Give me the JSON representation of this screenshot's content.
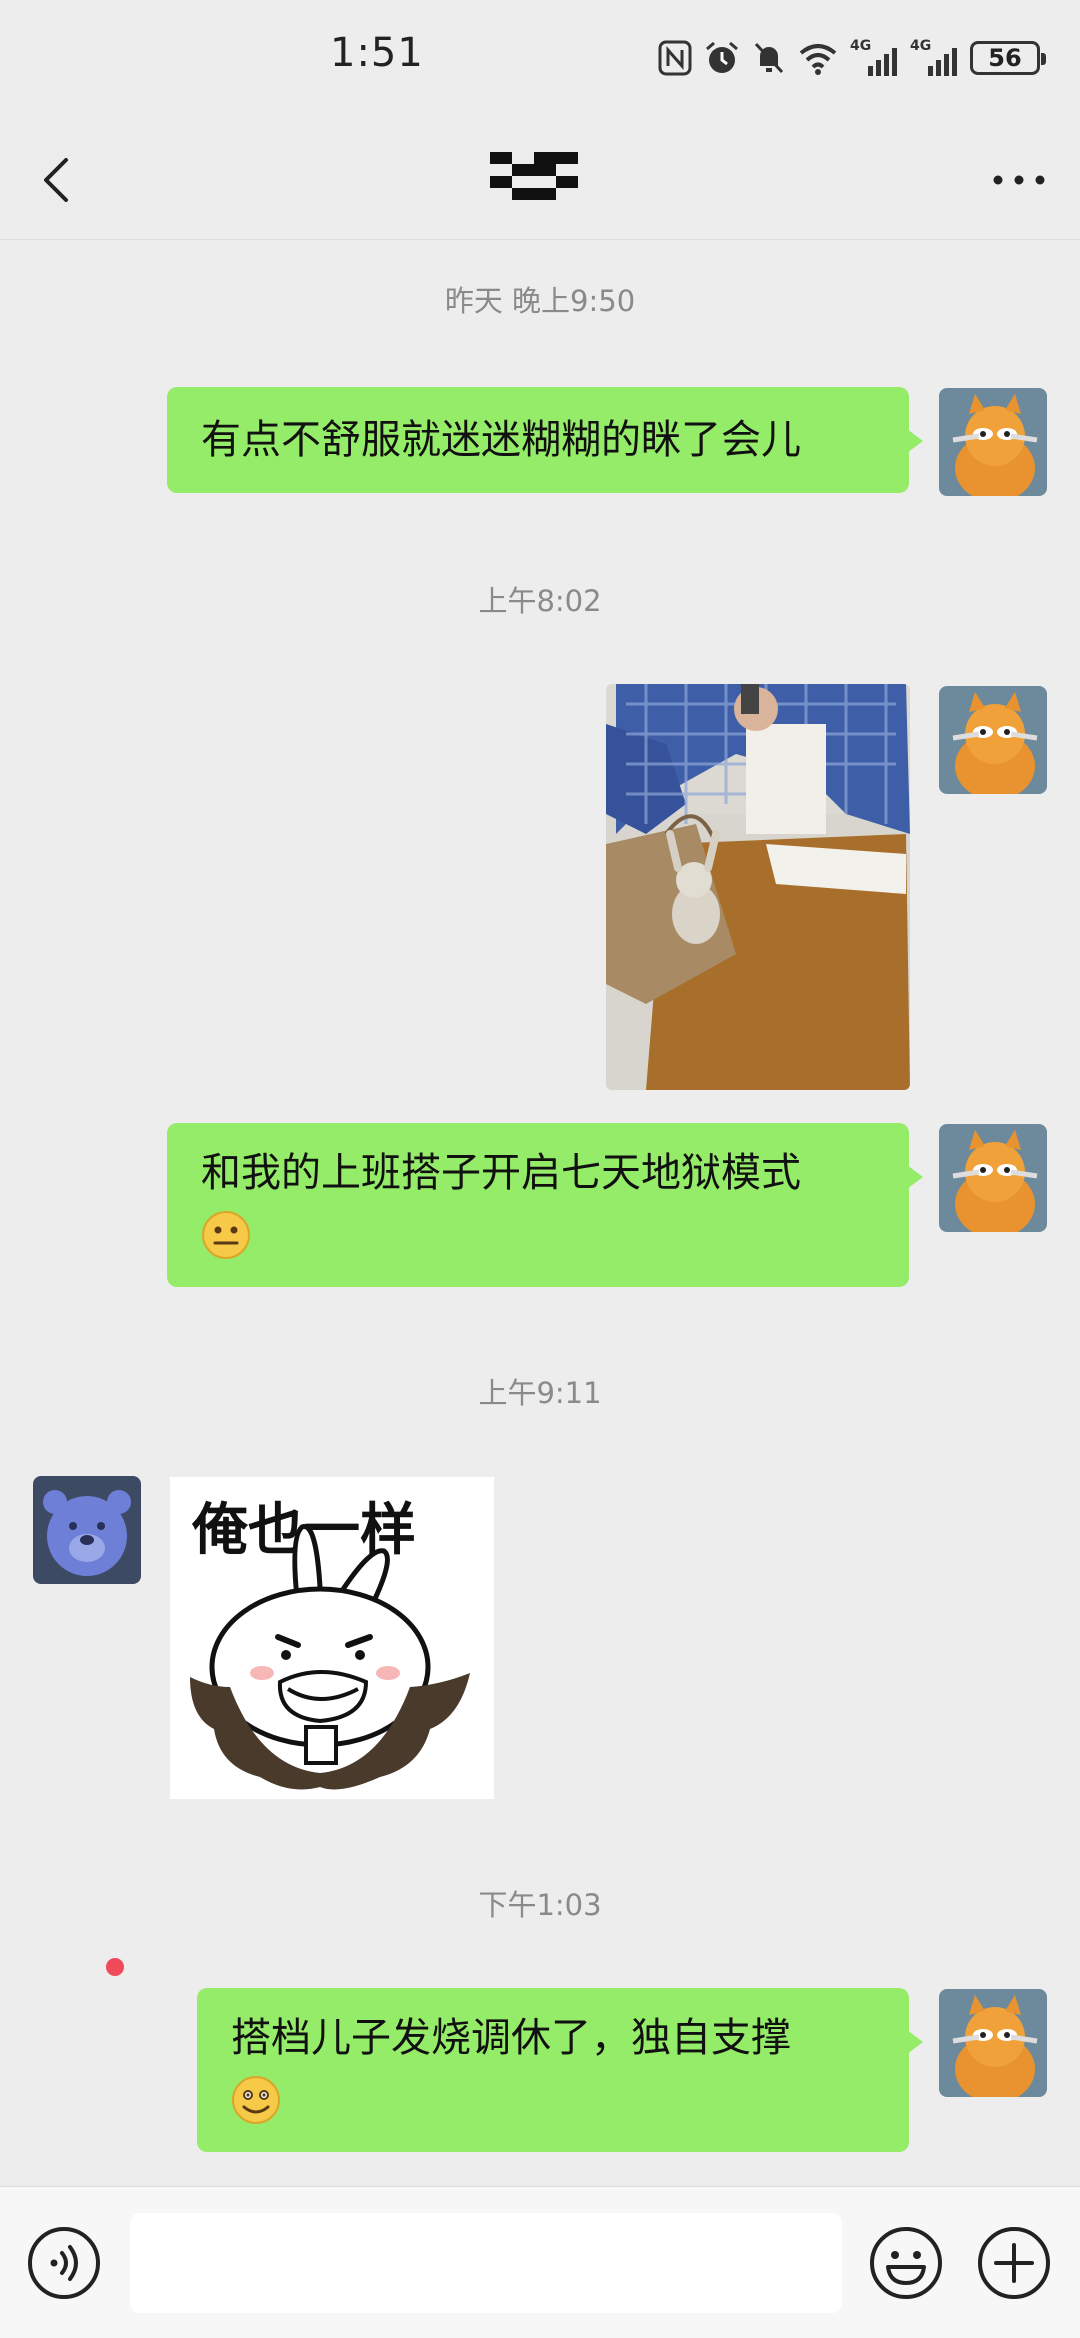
{
  "status_bar": {
    "time": "1:51",
    "net1": "4G",
    "net2": "4G",
    "battery": "56",
    "icons": [
      "nfc-icon",
      "alarm-icon",
      "mute-icon",
      "wifi-icon",
      "signal-icon",
      "signal-icon",
      "battery-icon"
    ]
  },
  "header": {
    "back_icon": "chevron-left-icon",
    "more_icon": "more-dots-icon"
  },
  "messages": [
    {
      "type": "time",
      "text": "昨天 晚上9:50"
    },
    {
      "type": "text",
      "side": "right",
      "text": "有点不舒服就迷迷糊糊的眯了会儿"
    },
    {
      "type": "time",
      "text": "上午8:02"
    },
    {
      "type": "image",
      "side": "right",
      "description_icon": "photo"
    },
    {
      "type": "text",
      "side": "right",
      "text": "和我的上班搭子开启七天地狱模式",
      "emoji": "neutral-face"
    },
    {
      "type": "time",
      "text": "上午9:11"
    },
    {
      "type": "sticker",
      "side": "left",
      "caption": "俺也一样"
    },
    {
      "type": "time",
      "text": "下午1:03"
    },
    {
      "type": "text",
      "side": "right",
      "text": "搭档儿子发烧调休了，独自支撑",
      "emoji": "woozy-face"
    }
  ],
  "input_bar": {
    "placeholder": "",
    "voice_icon": "voice-icon",
    "emoji_icon": "emoji-icon",
    "plus_icon": "plus-icon"
  },
  "colors": {
    "background": "#ededed",
    "bubble_green": "#95ec69",
    "timestamp_gray": "#8a8a8a",
    "unread_red": "#f04a5a"
  }
}
